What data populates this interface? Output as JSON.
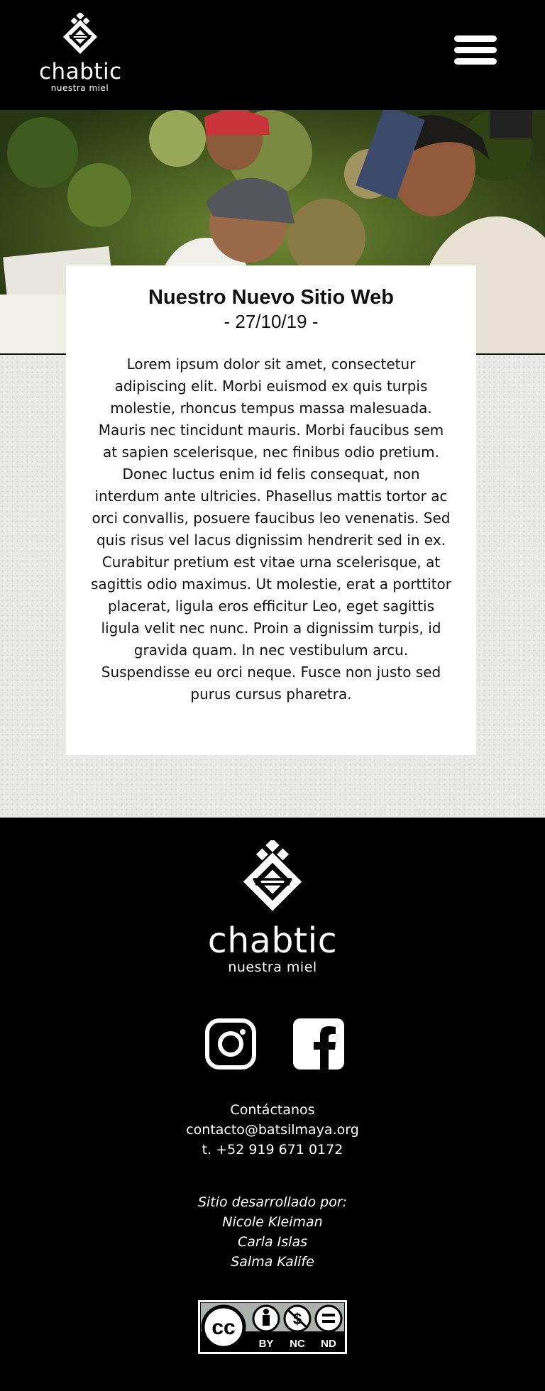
{
  "header": {
    "logo": {
      "brand": "chabtic",
      "tagline": "nuestra miel",
      "icon": "honeycomb-diamond-icon"
    },
    "menu_icon": "hamburger-icon"
  },
  "hero": {
    "image_alt": "Jóvenes revisando un panal en el monte"
  },
  "article": {
    "title": "Nuestro Nuevo Sitio Web",
    "date": "- 27/10/19 -",
    "body": "Lorem ipsum dolor sit amet, consectetur adipiscing elit. Morbi euismod ex quis turpis molestie, rhoncus tempus massa malesuada. Mauris nec tincidunt mauris. Morbi faucibus sem at sapien scelerisque, nec finibus odio pretium. Donec luctus enim id felis consequat, non interdum ante ultricies. Phasellus mattis tortor ac orci convallis, posuere faucibus leo venenatis. Sed quis risus vel lacus dignissim hendrerit sed in ex. Curabitur pretium est vitae urna scelerisque, at sagittis odio maximus. Ut molestie, erat a porttitor placerat, ligula eros efficitur Leo, eget sagittis ligula velit nec nunc. Proin a dignissim turpis, id gravida quam. In nec vestibulum arcu. Suspendisse eu orci neque. Fusce non justo sed purus cursus pharetra."
  },
  "footer": {
    "logo": {
      "brand": "chabtic",
      "tagline": "nuestra miel"
    },
    "social": {
      "instagram_icon": "instagram-icon",
      "facebook_icon": "facebook-icon"
    },
    "contact": {
      "heading": "Contáctanos",
      "email": "contacto@batsilmaya.org",
      "phone": "t. +52 919 671 0172"
    },
    "credits": {
      "heading": "Sitio desarrollado por:",
      "names": [
        "Nicole Kleiman",
        "Carla Islas",
        "Salma Kalife"
      ]
    },
    "license": {
      "cc": "cc",
      "by": "BY",
      "nc": "NC",
      "nd": "ND"
    }
  },
  "colors": {
    "background": "#000000",
    "paper": "#e9e9e8",
    "card": "#ffffff",
    "text": "#111111"
  }
}
